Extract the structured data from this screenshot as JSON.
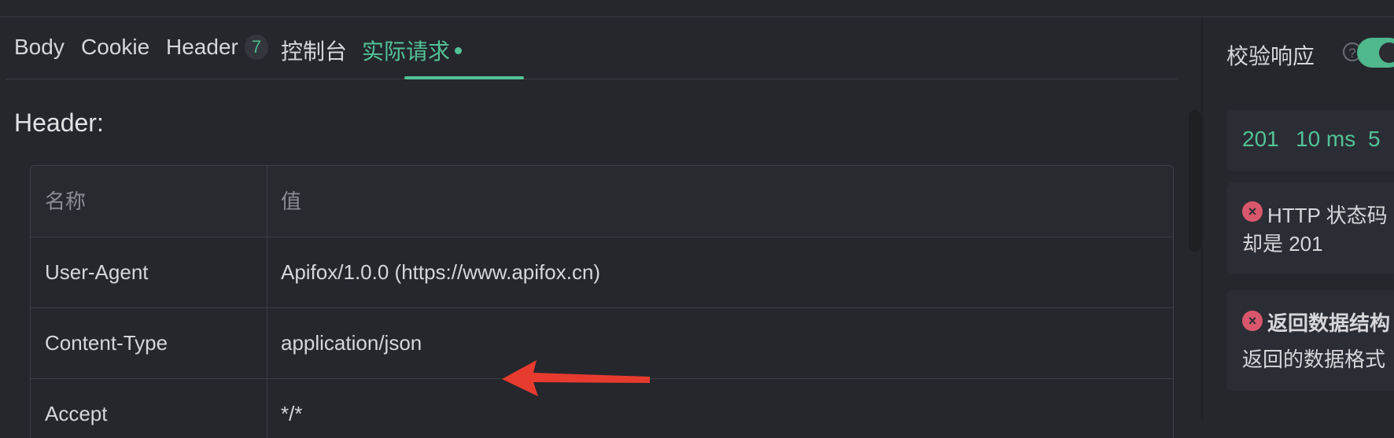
{
  "tabs": [
    {
      "label": "Body"
    },
    {
      "label": "Cookie"
    },
    {
      "label": "Header",
      "count": "7"
    },
    {
      "label": "控制台"
    },
    {
      "label": "实际请求",
      "active": true
    }
  ],
  "section": {
    "title": "Header:"
  },
  "table": {
    "columns": [
      "名称",
      "值"
    ],
    "rows": [
      [
        "User-Agent",
        "Apifox/1.0.0 (https://www.apifox.cn)"
      ],
      [
        "Content-Type",
        "application/json"
      ],
      [
        "Accept",
        "*/*"
      ]
    ]
  },
  "right_panel": {
    "validate_label": "校验响应",
    "help_icon": "?",
    "toggle_on": true,
    "status_code": "201",
    "time": "10 ms",
    "size_partial": "5",
    "errors": [
      {
        "icon": "×",
        "line1": "HTTP 状态码",
        "line2": "却是 201"
      },
      {
        "icon": "×",
        "line1": "返回数据结构",
        "line2": "返回的数据格式"
      }
    ]
  },
  "colors": {
    "accent": "#53c297",
    "error": "#d9576d",
    "annotation_arrow": "#e63b2e"
  }
}
